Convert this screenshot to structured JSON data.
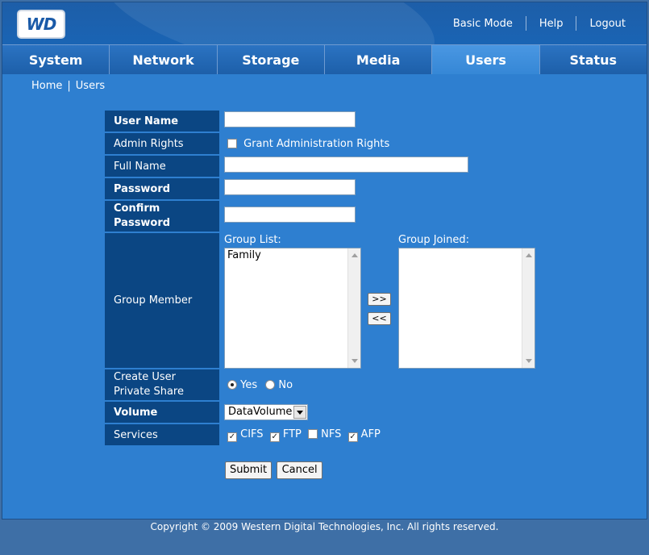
{
  "header": {
    "logo_text": "WD",
    "links": {
      "basic_mode": "Basic Mode",
      "help": "Help",
      "logout": "Logout"
    }
  },
  "tabs": [
    {
      "label": "System"
    },
    {
      "label": "Network"
    },
    {
      "label": "Storage"
    },
    {
      "label": "Media"
    },
    {
      "label": "Users"
    },
    {
      "label": "Status"
    }
  ],
  "active_tab": "Users",
  "breadcrumb": {
    "home": "Home",
    "separator": "|",
    "current": "Users"
  },
  "form": {
    "user_name": {
      "label": "User Name",
      "value": ""
    },
    "admin_rights": {
      "label": "Admin Rights",
      "checkbox_label": "Grant Administration Rights",
      "checked": false
    },
    "full_name": {
      "label": "Full Name",
      "value": ""
    },
    "password": {
      "label": "Password",
      "value": ""
    },
    "confirm_password": {
      "label_line1": "Confirm",
      "label_line2": "Password",
      "value": ""
    },
    "group_member": {
      "label": "Group Member",
      "group_list_label": "Group List:",
      "group_list_items": [
        "Family"
      ],
      "group_joined_label": "Group Joined:",
      "group_joined_items": [],
      "add_label": ">>",
      "remove_label": "<<"
    },
    "private_share": {
      "label_line1": "Create User",
      "label_line2": "Private Share",
      "yes_label": "Yes",
      "no_label": "No",
      "selected": "Yes"
    },
    "volume": {
      "label": "Volume",
      "selected": "DataVolume"
    },
    "services": {
      "label": "Services",
      "options": [
        {
          "label": "CIFS",
          "checked": true
        },
        {
          "label": "FTP",
          "checked": true
        },
        {
          "label": "NFS",
          "checked": false
        },
        {
          "label": "AFP",
          "checked": true
        }
      ]
    },
    "submit_label": "Submit",
    "cancel_label": "Cancel"
  },
  "footer": {
    "copyright": "Copyright © 2009 Western Digital Technologies, Inc. All rights reserved."
  },
  "colors": {
    "page_bg": "#2e7fd0",
    "label_bg": "#0b4683",
    "header_bg": "#1a5aa3",
    "active_tab": "#3a8ad8"
  }
}
